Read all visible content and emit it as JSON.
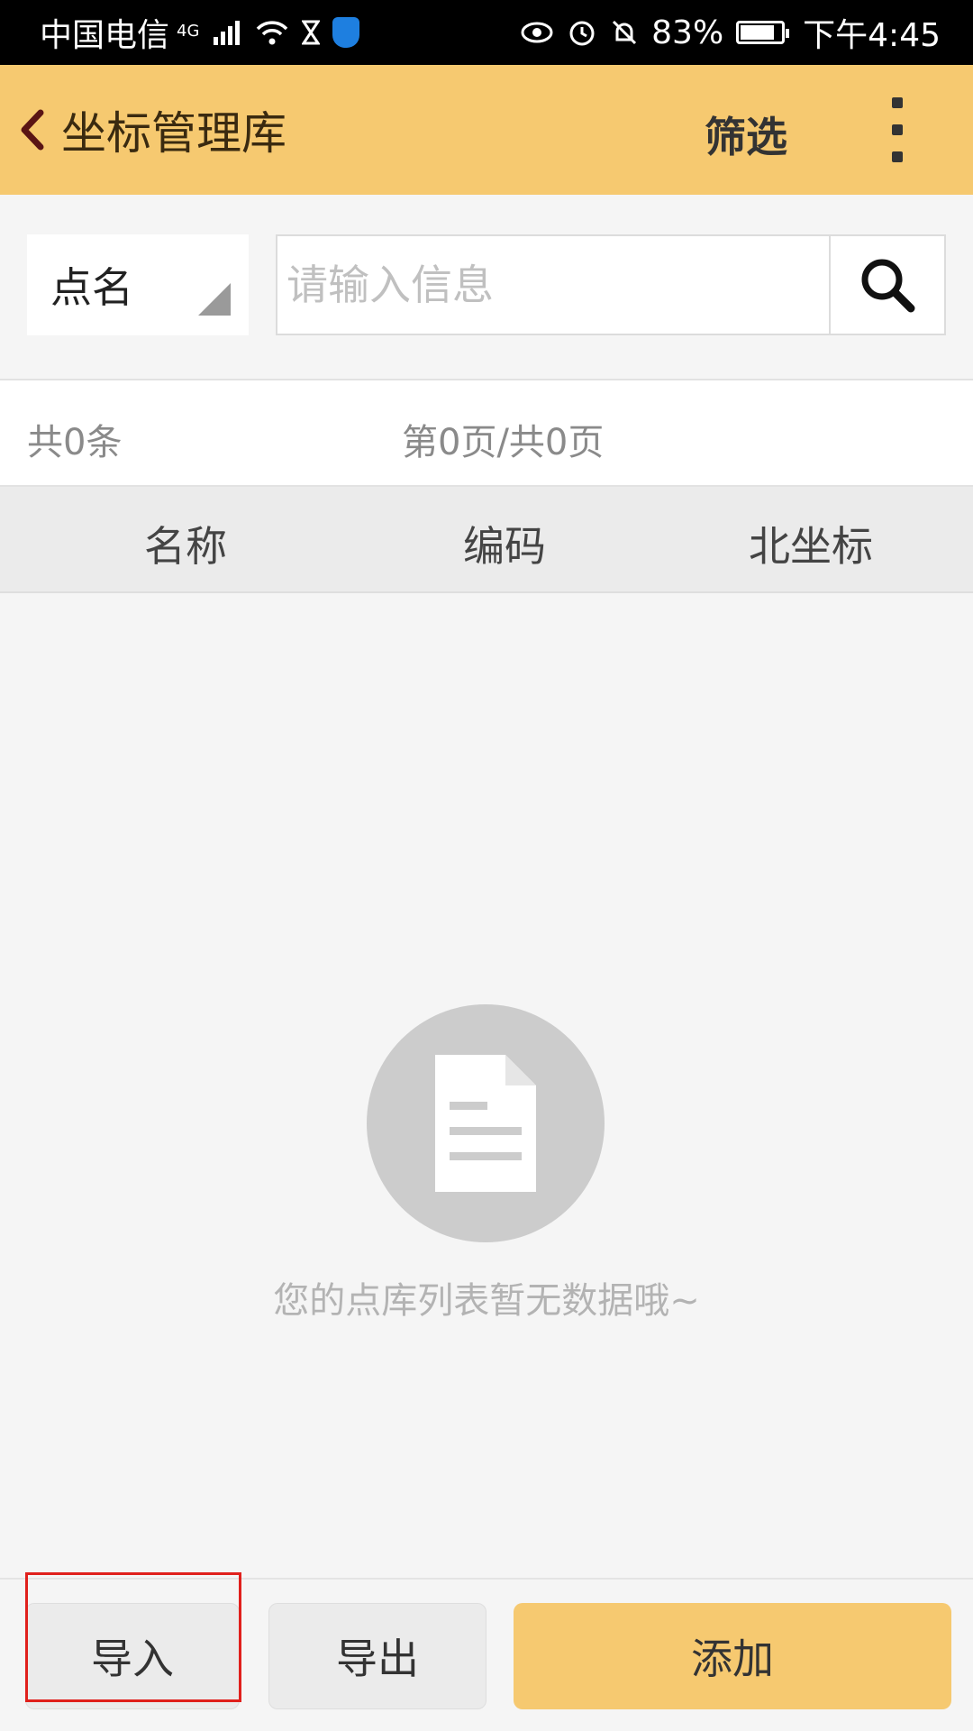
{
  "status_bar": {
    "carrier": "中国电信",
    "network": "4G",
    "battery": "83%",
    "battery_level": 0.83,
    "time": "下午4:45"
  },
  "header": {
    "title": "坐标管理库",
    "filter_label": "筛选"
  },
  "search": {
    "field_selected": "点名",
    "placeholder": "请输入信息"
  },
  "info": {
    "count_text": "共0条",
    "page_text": "第0页/共0页"
  },
  "table": {
    "columns": [
      "名称",
      "编码",
      "北坐标"
    ]
  },
  "empty_state": {
    "message": "您的点库列表暂无数据哦~"
  },
  "bottom_bar": {
    "import_label": "导入",
    "export_label": "导出",
    "add_label": "添加"
  },
  "colors": {
    "accent": "#f6c970",
    "highlight": "#e0201c"
  }
}
